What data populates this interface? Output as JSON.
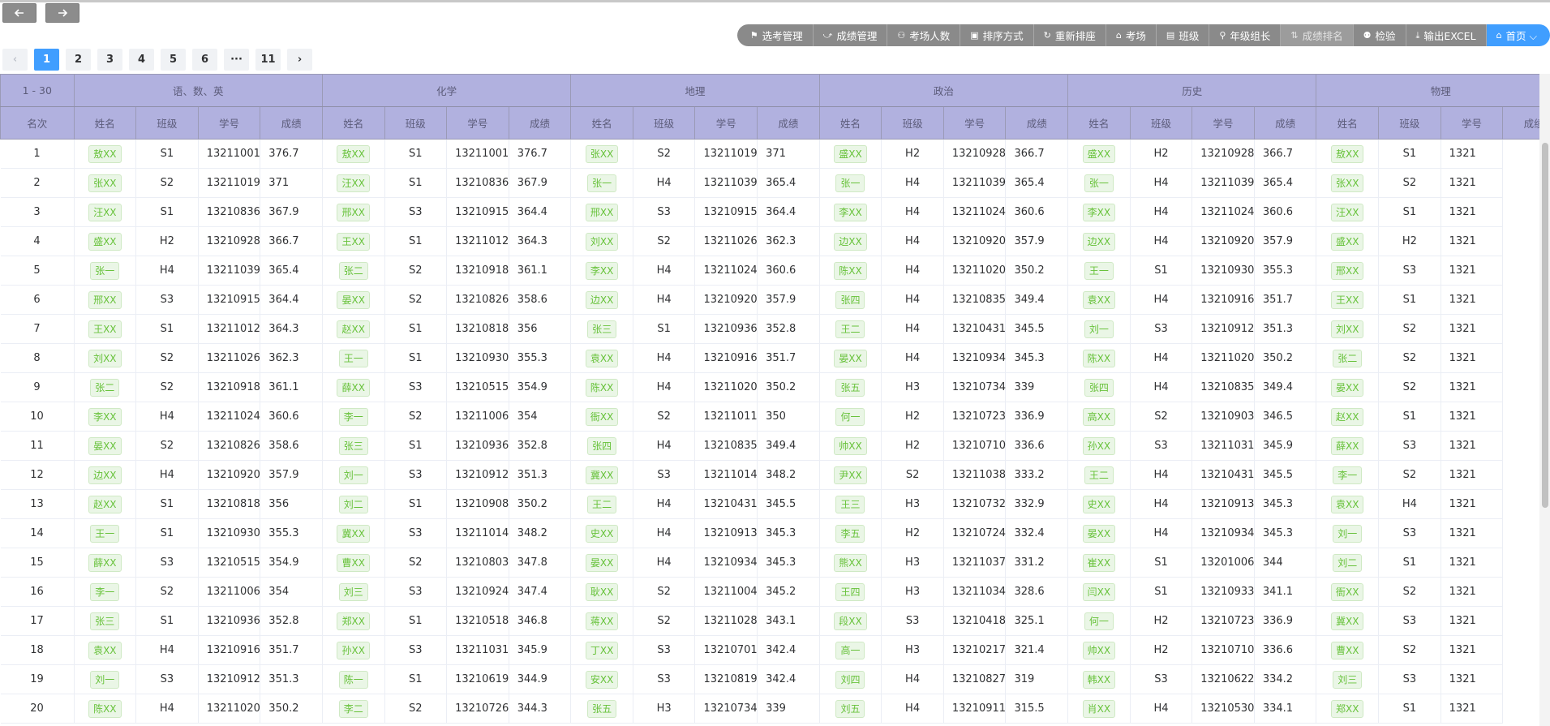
{
  "nav": {
    "back_icon": "arrow-left-icon",
    "forward_icon": "arrow-right-icon"
  },
  "toolbar": [
    {
      "label": "选考管理",
      "icon": "⚑",
      "name": "toolbar-elective-management",
      "style": ""
    },
    {
      "label": "成绩管理",
      "icon": "⤻",
      "name": "toolbar-score-management",
      "style": ""
    },
    {
      "label": "考场人数",
      "icon": "⚇",
      "name": "toolbar-room-count",
      "style": ""
    },
    {
      "label": "排序方式",
      "icon": "▣",
      "name": "toolbar-sort-mode",
      "style": ""
    },
    {
      "label": "重新排座",
      "icon": "↻",
      "name": "toolbar-reseat",
      "style": ""
    },
    {
      "label": "考场",
      "icon": "⌂",
      "name": "toolbar-exam-room",
      "style": ""
    },
    {
      "label": "班级",
      "icon": "▤",
      "name": "toolbar-class",
      "style": ""
    },
    {
      "label": "年级组长",
      "icon": "⚲",
      "name": "toolbar-grade-leader",
      "style": ""
    },
    {
      "label": "成绩排名",
      "icon": "⇅",
      "name": "toolbar-score-ranking",
      "style": "dim"
    },
    {
      "label": "检验",
      "icon": "⚉",
      "name": "toolbar-check",
      "style": ""
    },
    {
      "label": "输出EXCEL",
      "icon": "⤓",
      "name": "toolbar-export-excel",
      "style": ""
    },
    {
      "label": "首页 ⌵",
      "icon": "⌂",
      "name": "toolbar-home",
      "style": "home"
    }
  ],
  "pagination": {
    "pages": [
      "1",
      "2",
      "3",
      "4",
      "5",
      "6",
      "···",
      "11"
    ],
    "active": "1",
    "prev": "‹",
    "next": "›"
  },
  "table": {
    "range_label": "1 - 30",
    "subject_groups": [
      "语、数、英",
      "化学",
      "地理",
      "政治",
      "历史",
      "物理"
    ],
    "rank_header": "名次",
    "sub_headers": [
      "姓名",
      "班级",
      "学号",
      "成绩"
    ],
    "rows": [
      [
        "1",
        "敖XX",
        "S1",
        "13211001",
        "376.7",
        "敖XX",
        "S1",
        "13211001",
        "376.7",
        "张XX",
        "S2",
        "13211019",
        "371",
        "盛XX",
        "H2",
        "13210928",
        "366.7",
        "盛XX",
        "H2",
        "13210928",
        "366.7",
        "敖XX",
        "S1",
        "1321"
      ],
      [
        "2",
        "张XX",
        "S2",
        "13211019",
        "371",
        "汪XX",
        "S1",
        "13210836",
        "367.9",
        "张一",
        "H4",
        "13211039",
        "365.4",
        "张一",
        "H4",
        "13211039",
        "365.4",
        "张一",
        "H4",
        "13211039",
        "365.4",
        "张XX",
        "S2",
        "1321"
      ],
      [
        "3",
        "汪XX",
        "S1",
        "13210836",
        "367.9",
        "邢XX",
        "S3",
        "13210915",
        "364.4",
        "邢XX",
        "S3",
        "13210915",
        "364.4",
        "李XX",
        "H4",
        "13211024",
        "360.6",
        "李XX",
        "H4",
        "13211024",
        "360.6",
        "汪XX",
        "S1",
        "1321"
      ],
      [
        "4",
        "盛XX",
        "H2",
        "13210928",
        "366.7",
        "王XX",
        "S1",
        "13211012",
        "364.3",
        "刘XX",
        "S2",
        "13211026",
        "362.3",
        "边XX",
        "H4",
        "13210920",
        "357.9",
        "边XX",
        "H4",
        "13210920",
        "357.9",
        "盛XX",
        "H2",
        "1321"
      ],
      [
        "5",
        "张一",
        "H4",
        "13211039",
        "365.4",
        "张二",
        "S2",
        "13210918",
        "361.1",
        "李XX",
        "H4",
        "13211024",
        "360.6",
        "陈XX",
        "H4",
        "13211020",
        "350.2",
        "王一",
        "S1",
        "13210930",
        "355.3",
        "邢XX",
        "S3",
        "1321"
      ],
      [
        "6",
        "邢XX",
        "S3",
        "13210915",
        "364.4",
        "晏XX",
        "S2",
        "13210826",
        "358.6",
        "边XX",
        "H4",
        "13210920",
        "357.9",
        "张四",
        "H4",
        "13210835",
        "349.4",
        "袁XX",
        "H4",
        "13210916",
        "351.7",
        "王XX",
        "S1",
        "1321"
      ],
      [
        "7",
        "王XX",
        "S1",
        "13211012",
        "364.3",
        "赵XX",
        "S1",
        "13210818",
        "356",
        "张三",
        "S1",
        "13210936",
        "352.8",
        "王二",
        "H4",
        "13210431",
        "345.5",
        "刘一",
        "S3",
        "13210912",
        "351.3",
        "刘XX",
        "S2",
        "1321"
      ],
      [
        "8",
        "刘XX",
        "S2",
        "13211026",
        "362.3",
        "王一",
        "S1",
        "13210930",
        "355.3",
        "袁XX",
        "H4",
        "13210916",
        "351.7",
        "晏XX",
        "H4",
        "13210934",
        "345.3",
        "陈XX",
        "H4",
        "13211020",
        "350.2",
        "张二",
        "S2",
        "1321"
      ],
      [
        "9",
        "张二",
        "S2",
        "13210918",
        "361.1",
        "薛XX",
        "S3",
        "13210515",
        "354.9",
        "陈XX",
        "H4",
        "13211020",
        "350.2",
        "张五",
        "H3",
        "13210734",
        "339",
        "张四",
        "H4",
        "13210835",
        "349.4",
        "晏XX",
        "S2",
        "1321"
      ],
      [
        "10",
        "李XX",
        "H4",
        "13211024",
        "360.6",
        "李一",
        "S2",
        "13211006",
        "354",
        "衙XX",
        "S2",
        "13211011",
        "350",
        "何一",
        "H2",
        "13210723",
        "336.9",
        "高XX",
        "S2",
        "13210903",
        "346.5",
        "赵XX",
        "S1",
        "1321"
      ],
      [
        "11",
        "晏XX",
        "S2",
        "13210826",
        "358.6",
        "张三",
        "S1",
        "13210936",
        "352.8",
        "张四",
        "H4",
        "13210835",
        "349.4",
        "帅XX",
        "H2",
        "13210710",
        "336.6",
        "孙XX",
        "S3",
        "13211031",
        "345.9",
        "薛XX",
        "S3",
        "1321"
      ],
      [
        "12",
        "边XX",
        "H4",
        "13210920",
        "357.9",
        "刘一",
        "S3",
        "13210912",
        "351.3",
        "冀XX",
        "S3",
        "13211014",
        "348.2",
        "尹XX",
        "S2",
        "13211038",
        "333.2",
        "王二",
        "H4",
        "13210431",
        "345.5",
        "李一",
        "S2",
        "1321"
      ],
      [
        "13",
        "赵XX",
        "S1",
        "13210818",
        "356",
        "刘二",
        "S1",
        "13210908",
        "350.2",
        "王二",
        "H4",
        "13210431",
        "345.5",
        "王三",
        "H3",
        "13210732",
        "332.9",
        "史XX",
        "H4",
        "13210913",
        "345.3",
        "袁XX",
        "H4",
        "1321"
      ],
      [
        "14",
        "王一",
        "S1",
        "13210930",
        "355.3",
        "冀XX",
        "S3",
        "13211014",
        "348.2",
        "史XX",
        "H4",
        "13210913",
        "345.3",
        "李五",
        "H2",
        "13210724",
        "332.4",
        "晏XX",
        "H4",
        "13210934",
        "345.3",
        "刘一",
        "S3",
        "1321"
      ],
      [
        "15",
        "薛XX",
        "S3",
        "13210515",
        "354.9",
        "曹XX",
        "S2",
        "13210803",
        "347.8",
        "晏XX",
        "H4",
        "13210934",
        "345.3",
        "熊XX",
        "H3",
        "13211037",
        "331.2",
        "崔XX",
        "S1",
        "13201006",
        "344",
        "刘二",
        "S1",
        "1321"
      ],
      [
        "16",
        "李一",
        "S2",
        "13211006",
        "354",
        "刘三",
        "S3",
        "13210924",
        "347.4",
        "耿XX",
        "S2",
        "13211004",
        "345.2",
        "王四",
        "H3",
        "13211034",
        "328.6",
        "闫XX",
        "S1",
        "13210933",
        "341.1",
        "衙XX",
        "S2",
        "1321"
      ],
      [
        "17",
        "张三",
        "S1",
        "13210936",
        "352.8",
        "郑XX",
        "S1",
        "13210518",
        "346.8",
        "蒋XX",
        "S2",
        "13211028",
        "343.1",
        "段XX",
        "S3",
        "13210418",
        "325.1",
        "何一",
        "H2",
        "13210723",
        "336.9",
        "冀XX",
        "S3",
        "1321"
      ],
      [
        "18",
        "袁XX",
        "H4",
        "13210916",
        "351.7",
        "孙XX",
        "S3",
        "13211031",
        "345.9",
        "丁XX",
        "S3",
        "13210701",
        "342.4",
        "高一",
        "H3",
        "13210217",
        "321.4",
        "帅XX",
        "H2",
        "13210710",
        "336.6",
        "曹XX",
        "S2",
        "1321"
      ],
      [
        "19",
        "刘一",
        "S3",
        "13210912",
        "351.3",
        "陈一",
        "S1",
        "13210619",
        "344.9",
        "安XX",
        "S3",
        "13210819",
        "342.4",
        "刘四",
        "H4",
        "13210827",
        "319",
        "韩XX",
        "S3",
        "13210622",
        "334.2",
        "刘三",
        "S3",
        "1321"
      ],
      [
        "20",
        "陈XX",
        "H4",
        "13211020",
        "350.2",
        "李二",
        "S2",
        "13210726",
        "344.3",
        "张五",
        "H3",
        "13210734",
        "339",
        "刘五",
        "H4",
        "13210911",
        "315.5",
        "肖XX",
        "H4",
        "13210530",
        "334.1",
        "郑XX",
        "S1",
        "1321"
      ]
    ]
  }
}
